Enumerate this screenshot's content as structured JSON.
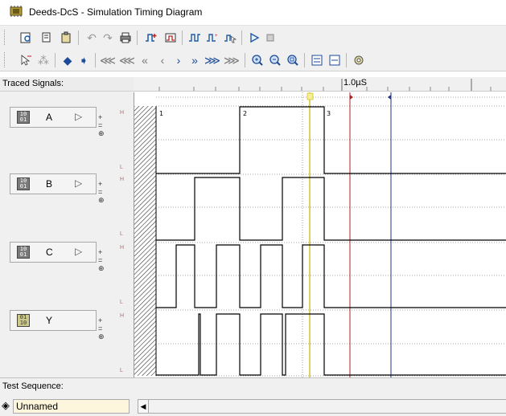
{
  "window": {
    "title": "Deeds-DcS - Simulation Timing Diagram",
    "app_icon": "circuit-board-icon"
  },
  "toolbar1": {
    "buttons": [
      "print-preview-icon",
      "copy-icon",
      "clipboard-icon",
      "undo-icon",
      "redo-icon",
      "print-icon",
      "add-signal-icon",
      "remove-signal-icon",
      "zoom-window-icon",
      "zoom-fit-icon",
      "signal-select-icon",
      "play-icon",
      "stop-icon"
    ]
  },
  "toolbar2": {
    "buttons": [
      "pointer-icon",
      "grid-icon",
      "step-back-icon",
      "step-forward-icon",
      "home-icon",
      "rewind-fast-icon",
      "rewind-icon",
      "step-left-icon",
      "step-right-icon",
      "forward-icon",
      "forward-fast-icon",
      "end-icon",
      "zoom-in-icon",
      "zoom-out-icon",
      "zoom-fit-icon",
      "expand-icon",
      "collapse-icon",
      "settings-icon"
    ]
  },
  "traced_signals": {
    "header": "Traced Signals:",
    "signals": [
      {
        "name": "A",
        "type": "input"
      },
      {
        "name": "B",
        "type": "input"
      },
      {
        "name": "C",
        "type": "input"
      },
      {
        "name": "Y",
        "type": "output"
      }
    ],
    "high_label": "H",
    "low_label": "L"
  },
  "timeline": {
    "tick_label": "1.0µS"
  },
  "cursors": {
    "labels": [
      "1",
      "2",
      "3"
    ]
  },
  "test_sequence": {
    "label": "Test Sequence:",
    "value": "Unnamed"
  },
  "colors": {
    "window_bg": "#f0f0f0",
    "wave_bg": "#ffffff",
    "trace": "#000000",
    "cursor_yellow": "#c8b400",
    "cursor_red": "#b02020",
    "cursor_blue": "#20308a",
    "test_sequence_field": "#fdf6dc"
  }
}
